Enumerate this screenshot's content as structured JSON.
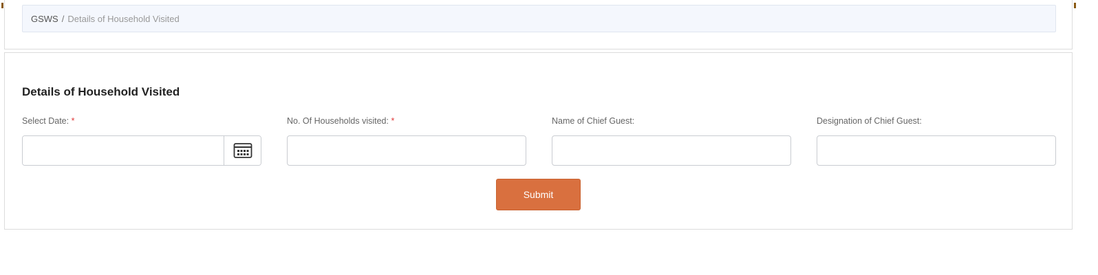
{
  "breadcrumb": {
    "home": "GSWS",
    "separator": "/",
    "current": "Details of Household Visited"
  },
  "form": {
    "title": "Details of Household Visited",
    "fields": [
      {
        "label": "Select Date:",
        "required_mark": "*",
        "value": "",
        "icon": "calendar-icon"
      },
      {
        "label": "No. Of Households visited:",
        "required_mark": "*",
        "value": ""
      },
      {
        "label": "Name of Chief Guest:",
        "value": ""
      },
      {
        "label": "Designation of Chief Guest:",
        "value": ""
      }
    ],
    "submit_label": "Submit"
  },
  "colors": {
    "submit_bg": "#d9703f",
    "breadcrumb_bg": "#f4f7fd",
    "required": "#e03a3a",
    "corner_mark": "#8a5a14"
  }
}
